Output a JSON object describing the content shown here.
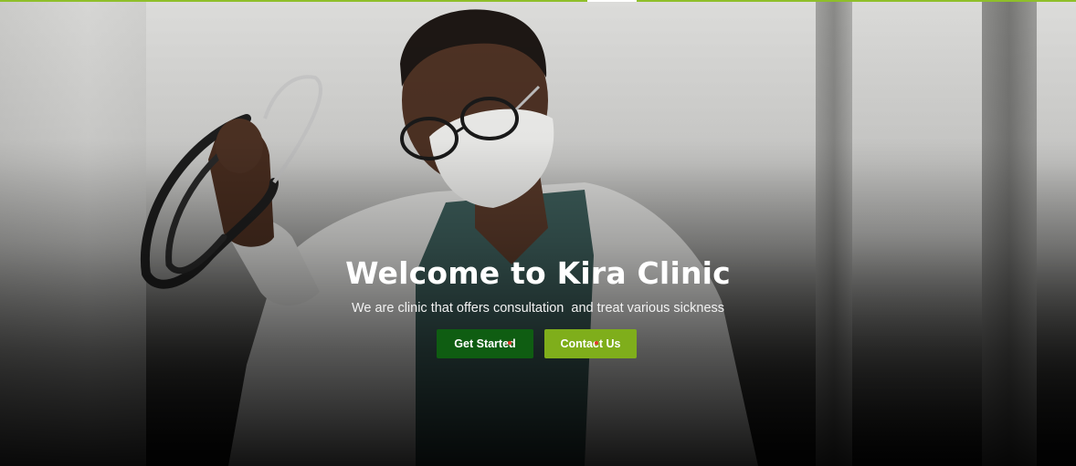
{
  "hero": {
    "title": "Welcome to Kira Clinic",
    "subtitle": "We are clinic that offers consultation  and treat various sickness",
    "background_image": "doctor-with-stethoscope-photo",
    "accent_color": "#8fbf2a"
  },
  "buttons": {
    "get_started": {
      "label": "Get Started",
      "color": "#0f5d12"
    },
    "contact_us": {
      "label": "Contact Us",
      "color": "#7fae1b"
    }
  }
}
